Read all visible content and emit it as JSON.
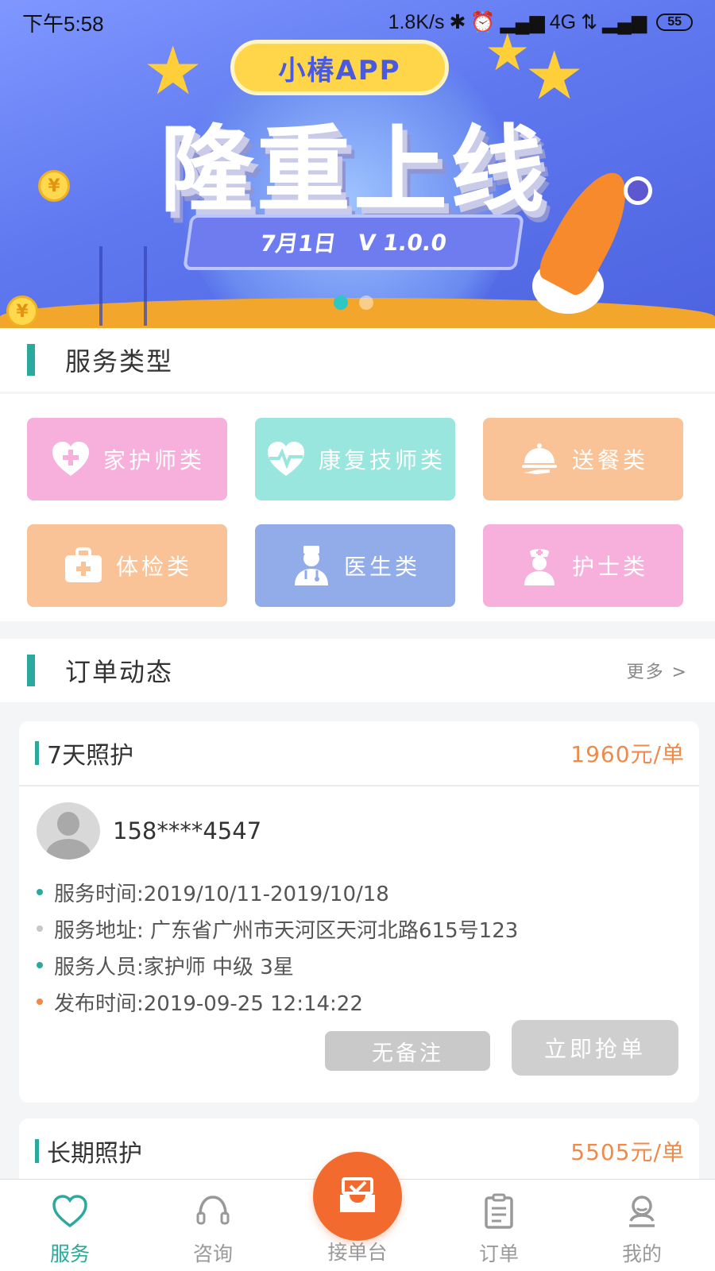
{
  "status_bar": {
    "time": "下午5:58",
    "speed": "1.8K/s",
    "network": "4G",
    "battery": "55"
  },
  "banner": {
    "app_name": "小椿APP",
    "headline": "隆重上线",
    "date": "7月1日",
    "version": "V 1.0.0",
    "coin_symbol": "¥",
    "active_slide": 1,
    "slide_count": 2
  },
  "services_section": {
    "title": "服务类型",
    "items": [
      {
        "label": "家护师类",
        "icon": "heart-plus-icon",
        "color": "#f7b0dc"
      },
      {
        "label": "康复技师类",
        "icon": "heartbeat-icon",
        "color": "#98e6dd"
      },
      {
        "label": "送餐类",
        "icon": "meal-cloche-icon",
        "color": "#f9c397"
      },
      {
        "label": "体检类",
        "icon": "medical-kit-icon",
        "color": "#f9c397"
      },
      {
        "label": "医生类",
        "icon": "doctor-icon",
        "color": "#91ace9"
      },
      {
        "label": "护士类",
        "icon": "nurse-icon",
        "color": "#f7b0dc"
      }
    ]
  },
  "orders_section": {
    "title": "订单动态",
    "more": "更多 >"
  },
  "orders": [
    {
      "title": "7天照护",
      "price": "1960元/单",
      "phone": "158****4547",
      "service_time": "服务时间:2019/10/11-2019/10/18",
      "address": "服务地址: 广东省广州市天河区天河北路615号123",
      "staff": "服务人员:家护师  中级  3星",
      "publish_time": "发布时间:2019-09-25 12:14:22",
      "note_button": "无备注",
      "grab_button": "立即抢单"
    },
    {
      "title": "长期照护",
      "price": "5505元/单"
    }
  ],
  "tabbar": {
    "items": [
      {
        "label": "服务",
        "icon": "heart-icon",
        "active": true
      },
      {
        "label": "咨询",
        "icon": "headset-icon",
        "active": false
      },
      {
        "label": "接单台",
        "icon": "inbox-check-icon",
        "active": false
      },
      {
        "label": "订单",
        "icon": "clipboard-icon",
        "active": false
      },
      {
        "label": "我的",
        "icon": "user-icon",
        "active": false
      }
    ]
  },
  "colors": {
    "accent": "#2aa99c",
    "price": "#f08a4a",
    "fab": "#f26a2e"
  }
}
